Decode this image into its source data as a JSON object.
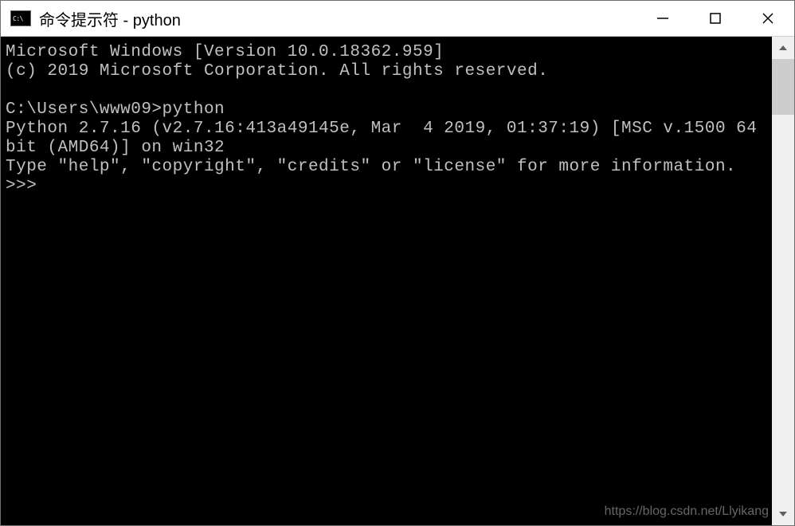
{
  "titlebar": {
    "icon_text": "C:\\",
    "title": "命令提示符 - python"
  },
  "terminal": {
    "lines": "Microsoft Windows [Version 10.0.18362.959]\n(c) 2019 Microsoft Corporation. All rights reserved.\n\nC:\\Users\\www09>python\nPython 2.7.16 (v2.7.16:413a49145e, Mar  4 2019, 01:37:19) [MSC v.1500 64 bit (AMD64)] on win32\nType \"help\", \"copyright\", \"credits\" or \"license\" for more information.\n>>> "
  },
  "watermark": "https://blog.csdn.net/Llyikang"
}
